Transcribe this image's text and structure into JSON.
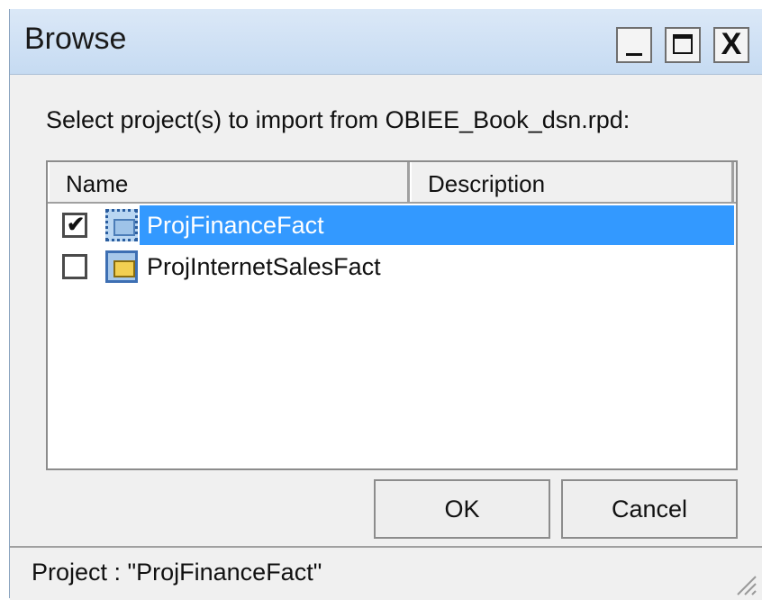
{
  "window": {
    "title": "Browse",
    "controls": {
      "minimize": "_",
      "maximize": "□",
      "close": "X"
    }
  },
  "prompt": "Select project(s) to import from OBIEE_Book_dsn.rpd:",
  "list": {
    "columns": [
      "Name",
      "Description"
    ],
    "rows": [
      {
        "name": "ProjFinanceFact",
        "description": "",
        "checked": true,
        "selected": true,
        "checkmark": "✔"
      },
      {
        "name": "ProjInternetSalesFact",
        "description": "",
        "checked": false,
        "selected": false
      }
    ]
  },
  "buttons": {
    "ok": "OK",
    "cancel": "Cancel"
  },
  "status": "Project : \"ProjFinanceFact\"",
  "colors": {
    "selection": "#3399ff",
    "titlebar": "#c6dbf2"
  },
  "icons": {
    "project": "project-folder-icon",
    "check": "check-icon"
  }
}
